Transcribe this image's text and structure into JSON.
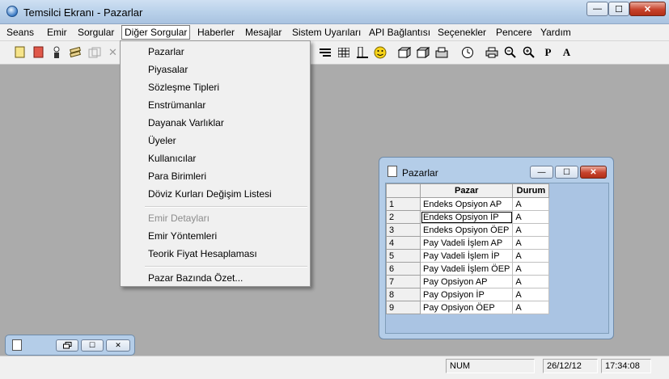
{
  "window": {
    "title": "Temsilci Ekranı - Pazarlar",
    "min_glyph": "—",
    "max_glyph": "☐",
    "close_glyph": "✕"
  },
  "menubar": {
    "items": [
      "Seans",
      "Emir",
      "Sorgular",
      "Diğer Sorgular",
      "Haberler",
      "Mesajlar",
      "Sistem Uyarıları",
      "API Bağlantısı",
      "Seçenekler",
      "Pencere",
      "Yardım"
    ],
    "active_index": 3
  },
  "toolbar": {
    "icons": [
      "new-doc-icon",
      "red-doc-icon",
      "person-icon",
      "stack-icon",
      "disabled-copy-icon",
      "close-x-icon",
      "list-icon",
      "columns-icon",
      "ruler-icon",
      "smiley-icon",
      "cube-icon",
      "cube2-icon",
      "tray-icon",
      "clock-icon",
      "printer-icon",
      "zoom-out-icon",
      "zoom-in-icon",
      "p-icon",
      "a-icon"
    ]
  },
  "dropdown": {
    "items": [
      {
        "label": "Pazarlar",
        "enabled": true
      },
      {
        "label": "Piyasalar",
        "enabled": true
      },
      {
        "label": "Sözleşme Tipleri",
        "enabled": true
      },
      {
        "label": "Enstrümanlar",
        "enabled": true
      },
      {
        "label": "Dayanak Varlıklar",
        "enabled": true
      },
      {
        "label": "Üyeler",
        "enabled": true
      },
      {
        "label": "Kullanıcılar",
        "enabled": true
      },
      {
        "label": "Para Birimleri",
        "enabled": true
      },
      {
        "label": "Döviz Kurları Değişim Listesi",
        "enabled": true
      },
      {
        "label": "Emir Detayları",
        "enabled": false
      },
      {
        "label": "Emir Yöntemleri",
        "enabled": true
      },
      {
        "label": "Teorik Fiyat Hesaplaması",
        "enabled": true
      },
      {
        "label": "Pazar Bazında Özet...",
        "enabled": true
      }
    ]
  },
  "child_window": {
    "title": "Pazarlar",
    "columns": [
      "Pazar",
      "Durum"
    ],
    "rows": [
      {
        "num": "1",
        "pazar": "Endeks Opsiyon AP",
        "durum": "A"
      },
      {
        "num": "2",
        "pazar": "Endeks Opsiyon İP",
        "durum": "A"
      },
      {
        "num": "3",
        "pazar": "Endeks Opsiyon ÖEP",
        "durum": "A"
      },
      {
        "num": "4",
        "pazar": "Pay Vadeli İşlem AP",
        "durum": "A"
      },
      {
        "num": "5",
        "pazar": "Pay Vadeli İşlem İP",
        "durum": "A"
      },
      {
        "num": "6",
        "pazar": "Pay Vadeli İşlem ÖEP",
        "durum": "A"
      },
      {
        "num": "7",
        "pazar": "Pay Opsiyon AP",
        "durum": "A"
      },
      {
        "num": "8",
        "pazar": "Pay Opsiyon İP",
        "durum": "A"
      },
      {
        "num": "9",
        "pazar": "Pay Opsiyon ÖEP",
        "durum": "A"
      }
    ],
    "selected_row": 1
  },
  "statusbar": {
    "num": "NUM",
    "date": "26/12/12",
    "time": "17:34:08"
  },
  "colors": {
    "workspace": "#ababab",
    "child_frame": "#b4cde8",
    "close_button": "#c7422c"
  }
}
